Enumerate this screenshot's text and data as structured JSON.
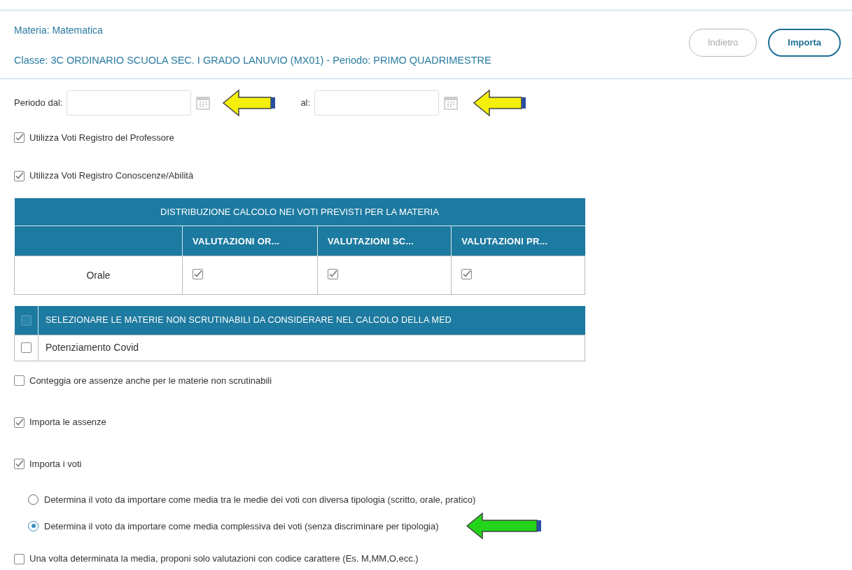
{
  "header": {
    "subject": "Materia: Matematica",
    "class_line": "Classe: 3C ORDINARIO SCUOLA SEC. I GRADO LANUVIO (MX01) - Periodo: PRIMO QUADRIMESTRE",
    "buttons": [
      {
        "label": "Indietro",
        "disabled": true
      },
      {
        "label": "Importa",
        "disabled": false
      }
    ]
  },
  "period": {
    "from_label": "Periodo dal:",
    "to_label": "al:"
  },
  "options_top": [
    {
      "label": "Utilizza Voti Registro del Professore",
      "checked": true
    },
    {
      "label": "Utilizza Voti Registro Conoscenze/Abilità",
      "checked": true
    }
  ],
  "distribution_table": {
    "title": "DISTRIBUZIONE CALCOLO NEI VOTI PREVISTI PER LA MATERIA",
    "columns": [
      "VALUTAZIONI OR...",
      "VALUTAZIONI SC...",
      "VALUTAZIONI PR..."
    ],
    "rows": [
      {
        "label": "Orale",
        "checks": [
          true,
          true,
          true
        ]
      }
    ]
  },
  "subjects_table": {
    "header": "SELEZIONARE LE MATERIE NON SCRUTINABILI DA CONSIDERARE NEL CALCOLO DELLA MED",
    "header_checked": false,
    "rows": [
      {
        "label": "Potenziamento Covid",
        "checked": false
      }
    ]
  },
  "options_bottom": [
    {
      "label": "Conteggia ore assenze anche per le materie non scrutinabili",
      "checked": false
    },
    {
      "label": "Importa le assenze",
      "checked": true
    },
    {
      "label": "Importa i voti",
      "checked": true
    }
  ],
  "vote_mode": [
    {
      "label": "Determina il voto da importare come media tra le medie dei voti con diversa tipologia (scritto, orale, pratico)",
      "selected": false
    },
    {
      "label": "Determina il voto da importare come media complessiva dei voti (senza discriminare per tipologia)",
      "selected": true
    }
  ],
  "final_option": {
    "label": "Una volta determinata la media, proponi solo valutazioni con codice carattere (Es. M,MM,O,ecc.)",
    "checked": false
  }
}
